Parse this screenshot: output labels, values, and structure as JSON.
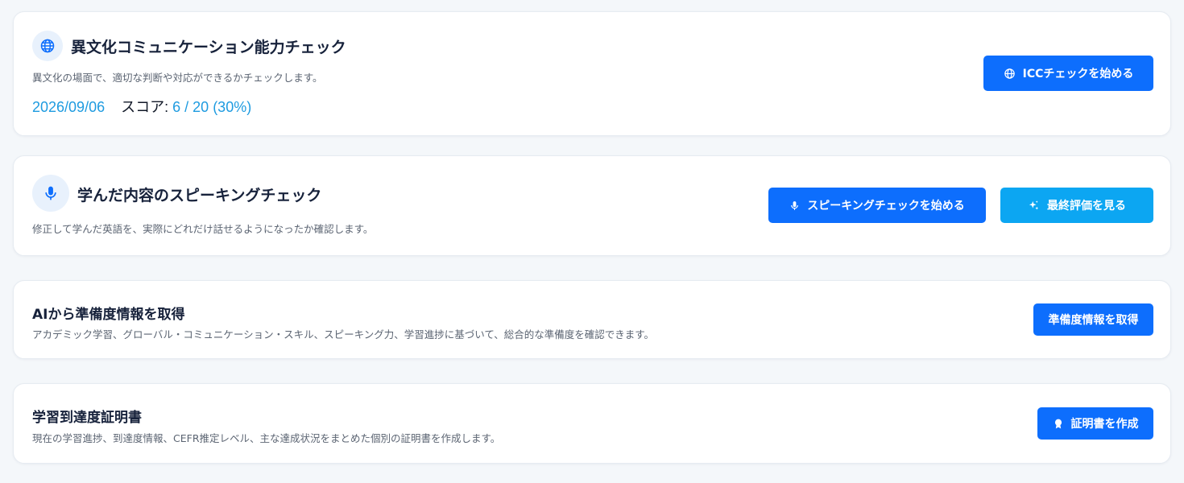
{
  "colors": {
    "primary_button": "#0d6efd",
    "secondary_button": "#0ca6f2",
    "accent_text": "#1e9be0",
    "icon_circle_bg": "#e8f1fc"
  },
  "icc": {
    "icon": "globe-icon",
    "title": "異文化コミュニケーション能力チェック",
    "description": "異文化の場面で、適切な判断や対応ができるかチェックします。",
    "date": "2026/09/06",
    "score_label": "スコア:",
    "score_value": "6 / 20 (30%)",
    "button_label": "ICCチェックを始める",
    "button_icon": "globe-icon"
  },
  "speaking": {
    "icon": "microphone-icon",
    "title": "学んだ内容のスピーキングチェック",
    "description": "修正して学んだ英語を、実際にどれだけ話せるようになったか確認します。",
    "start_button_label": "スピーキングチェックを始める",
    "start_button_icon": "microphone-icon",
    "final_button_label": "最終評価を見る",
    "final_button_icon": "sparkles-icon"
  },
  "ai_readiness": {
    "title": "AIから準備度情報を取得",
    "description": "アカデミック学習、グローバル・コミュニケーション・スキル、スピーキング力、学習進捗に基づいて、総合的な準備度を確認できます。",
    "button_label": "準備度情報を取得"
  },
  "certificate": {
    "title": "学習到達度証明書",
    "description": "現在の学習進捗、到達度情報、CEFR推定レベル、主な達成状況をまとめた個別の証明書を作成します。",
    "button_label": "証明書を作成",
    "button_icon": "award-icon"
  }
}
